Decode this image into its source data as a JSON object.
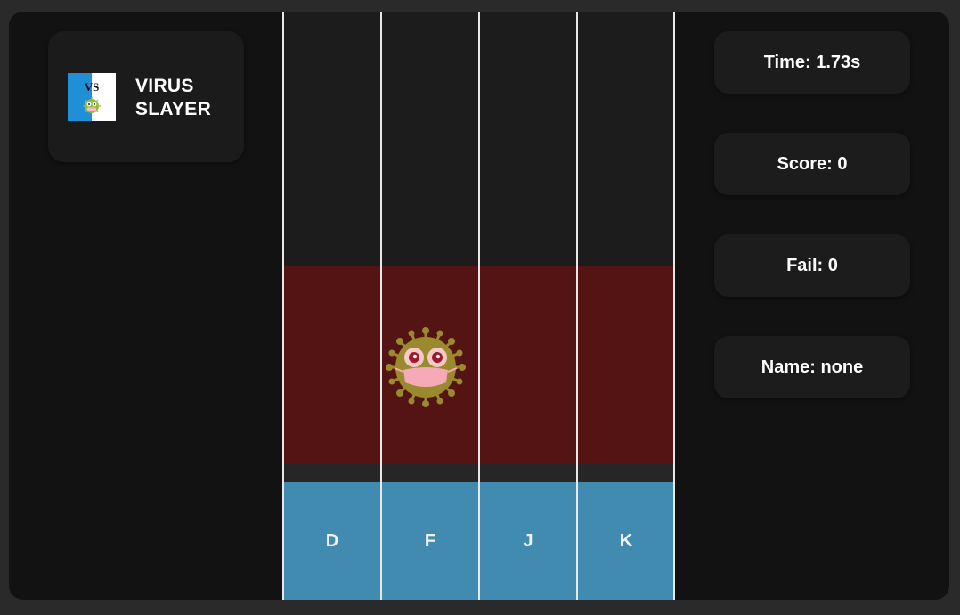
{
  "logo": {
    "badge_text": "VS",
    "title_line1": "VIRUS",
    "title_line2": "SLAYER"
  },
  "stats": {
    "time": "Time: 1.73s",
    "score": "Score: 0",
    "fail": "Fail: 0",
    "name": "Name: none"
  },
  "keys": [
    "D",
    "F",
    "J",
    "K"
  ],
  "enemy": {
    "icon": "virus-icon",
    "lane": "F"
  },
  "colors": {
    "background": "#121212",
    "hit_zone": "#551414",
    "key_bar": "#418bb0",
    "card": "#1c1c1d"
  }
}
